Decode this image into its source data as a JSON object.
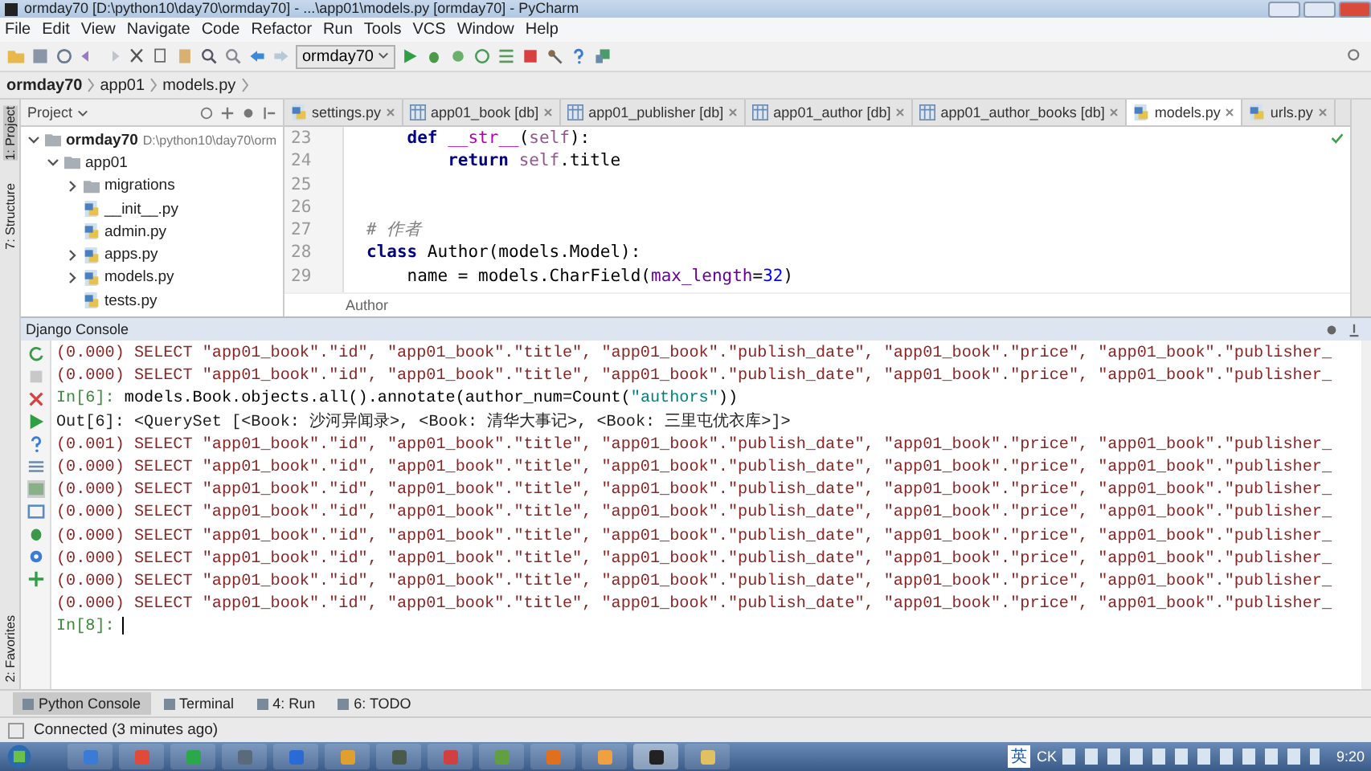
{
  "window": {
    "title": "ormday70 [D:\\python10\\day70\\ormday70] - ...\\app01\\models.py [ormday70] - PyCharm"
  },
  "menu": [
    "File",
    "Edit",
    "View",
    "Navigate",
    "Code",
    "Refactor",
    "Run",
    "Tools",
    "VCS",
    "Window",
    "Help"
  ],
  "toolbar": {
    "run_config": "ormday70"
  },
  "breadcrumb": [
    "ormday70",
    "app01",
    "models.py"
  ],
  "left_stripe": [
    {
      "label": "1: Project",
      "selected": true
    },
    {
      "label": "7: Structure",
      "selected": false
    },
    {
      "label": "2: Favorites",
      "selected": false
    }
  ],
  "project_panel": {
    "title": "Project",
    "tree": [
      {
        "label": "ormday70",
        "path": "D:\\python10\\day70\\orm",
        "kind": "folder",
        "expanded": true,
        "children": [
          {
            "label": "app01",
            "kind": "folder",
            "expanded": true,
            "children": [
              {
                "label": "migrations",
                "kind": "folder",
                "expanded": false
              },
              {
                "label": "__init__.py",
                "kind": "file"
              },
              {
                "label": "admin.py",
                "kind": "file"
              },
              {
                "label": "apps.py",
                "kind": "file",
                "expanded": false
              },
              {
                "label": "models.py",
                "kind": "file",
                "expanded": false
              },
              {
                "label": "tests.py",
                "kind": "file"
              }
            ]
          }
        ]
      }
    ]
  },
  "tabs": [
    {
      "label": "settings.py",
      "kind": "py",
      "selected": false
    },
    {
      "label": "app01_book [db]",
      "kind": "db",
      "selected": false
    },
    {
      "label": "app01_publisher [db]",
      "kind": "db",
      "selected": false
    },
    {
      "label": "app01_author [db]",
      "kind": "db",
      "selected": false
    },
    {
      "label": "app01_author_books [db]",
      "kind": "db",
      "selected": false
    },
    {
      "label": "models.py",
      "kind": "py",
      "selected": true
    },
    {
      "label": "urls.py",
      "kind": "py",
      "selected": false
    }
  ],
  "editor": {
    "lines": [
      {
        "number": "23",
        "tokens": [
          {
            "kind": "keyword",
            "text": "    def"
          },
          {
            "kind": "magic",
            "text": " __str__"
          },
          {
            "kind": "plain",
            "text": "("
          },
          {
            "kind": "self",
            "text": "self"
          },
          {
            "kind": "plain",
            "text": "):"
          }
        ]
      },
      {
        "number": "24",
        "tokens": [
          {
            "kind": "keyword",
            "text": "        return"
          },
          {
            "kind": "self",
            "text": " self"
          },
          {
            "kind": "plain",
            "text": ".title"
          }
        ]
      },
      {
        "number": "25"
      },
      {
        "number": "26"
      },
      {
        "number": "27",
        "tokens": [
          {
            "kind": "comment",
            "text": "# 作者"
          }
        ]
      },
      {
        "number": "28",
        "tokens": [
          {
            "kind": "keyword",
            "text": "class"
          },
          {
            "kind": "plain",
            "text": " Author(models.Model):"
          }
        ]
      },
      {
        "number": "29",
        "tokens": [
          {
            "kind": "plain",
            "text": "    name = models.CharField("
          },
          {
            "kind": "param",
            "text": "max_length"
          },
          {
            "kind": "plain",
            "text": "="
          },
          {
            "kind": "number",
            "text": "32"
          },
          {
            "kind": "plain",
            "text": ")"
          }
        ]
      }
    ],
    "breadcrumb": "Author"
  },
  "console": {
    "title": "Django Console",
    "lines": [
      {
        "kind": "sql",
        "text": "(0.000) SELECT \"app01_book\".\"id\", \"app01_book\".\"title\", \"app01_book\".\"publish_date\", \"app01_book\".\"price\", \"app01_book\".\"publisher_"
      },
      {
        "kind": "sql",
        "text": "(0.000) SELECT \"app01_book\".\"id\", \"app01_book\".\"title\", \"app01_book\".\"publish_date\", \"app01_book\".\"price\", \"app01_book\".\"publisher_"
      },
      {
        "kind": "input",
        "prompt": "In[6]:",
        "parts": [
          {
            "kind": "plain",
            "text": "models.Book.objects.all().annotate(author_num=Count("
          },
          {
            "kind": "string",
            "text": "\"authors\""
          },
          {
            "kind": "plain",
            "text": "))"
          }
        ]
      },
      {
        "kind": "output",
        "text": "Out[6]: <QuerySet [<Book: 沙河异闻录>, <Book: 清华大事记>, <Book: 三里屯优衣库>]>"
      },
      {
        "kind": "sql",
        "text": "(0.001) SELECT \"app01_book\".\"id\", \"app01_book\".\"title\", \"app01_book\".\"publish_date\", \"app01_book\".\"price\", \"app01_book\".\"publisher_"
      },
      {
        "kind": "sql",
        "text": "(0.000) SELECT \"app01_book\".\"id\", \"app01_book\".\"title\", \"app01_book\".\"publish_date\", \"app01_book\".\"price\", \"app01_book\".\"publisher_"
      },
      {
        "kind": "sql",
        "text": "(0.000) SELECT \"app01_book\".\"id\", \"app01_book\".\"title\", \"app01_book\".\"publish_date\", \"app01_book\".\"price\", \"app01_book\".\"publisher_"
      },
      {
        "kind": "sql",
        "text": "(0.000) SELECT \"app01_book\".\"id\", \"app01_book\".\"title\", \"app01_book\".\"publish_date\", \"app01_book\".\"price\", \"app01_book\".\"publisher_"
      },
      {
        "kind": "sql",
        "text": "(0.000) SELECT \"app01_book\".\"id\", \"app01_book\".\"title\", \"app01_book\".\"publish_date\", \"app01_book\".\"price\", \"app01_book\".\"publisher_"
      },
      {
        "kind": "sql",
        "text": "(0.000) SELECT \"app01_book\".\"id\", \"app01_book\".\"title\", \"app01_book\".\"publish_date\", \"app01_book\".\"price\", \"app01_book\".\"publisher_"
      },
      {
        "kind": "sql",
        "text": "(0.000) SELECT \"app01_book\".\"id\", \"app01_book\".\"title\", \"app01_book\".\"publish_date\", \"app01_book\".\"price\", \"app01_book\".\"publisher_"
      },
      {
        "kind": "sql",
        "text": "(0.000) SELECT \"app01_book\".\"id\", \"app01_book\".\"title\", \"app01_book\".\"publish_date\", \"app01_book\".\"price\", \"app01_book\".\"publisher_"
      }
    ],
    "prompt": "In[8]:"
  },
  "tool_tabs": [
    {
      "label": "Python Console",
      "selected": true
    },
    {
      "label": "Terminal",
      "selected": false
    },
    {
      "label": "4: Run",
      "selected": false
    },
    {
      "label": "6: TODO",
      "selected": false
    }
  ],
  "status_bar": "Connected (3 minutes ago)",
  "taskbar": {
    "ime": "英",
    "tray": "CK",
    "time": "9:20"
  }
}
